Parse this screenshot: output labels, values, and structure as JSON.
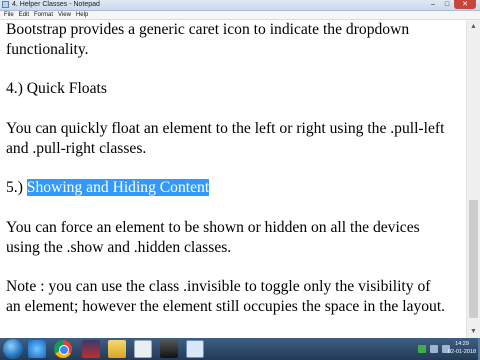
{
  "window": {
    "title": "4. Helper Classes - Notepad",
    "controls": {
      "minimize": "–",
      "maximize": "□",
      "close": "✕"
    }
  },
  "menu": [
    "File",
    "Edit",
    "Format",
    "View",
    "Help"
  ],
  "document": {
    "lines": [
      "Bootstrap provides a generic caret icon to indicate the dropdown",
      "functionality.",
      "",
      "4.) Quick Floats",
      "",
      "You can quickly float an element to the left or right using the .pull-left",
      "and .pull-right classes.",
      "",
      "5.) ",
      "",
      "You can force an element to be shown or hidden on all the devices",
      "using the .show and .hidden classes.",
      "",
      "Note :  you can use the class .invisible to toggle only the visibility of",
      "an element; however the element still occupies the space in the layout."
    ],
    "selected_text": "Showing and Hiding Content"
  },
  "scrollbar": {
    "up": "▲",
    "down": "▼"
  },
  "taskbar": {
    "clock_time": "14:29",
    "clock_date": "02-01-2018"
  }
}
